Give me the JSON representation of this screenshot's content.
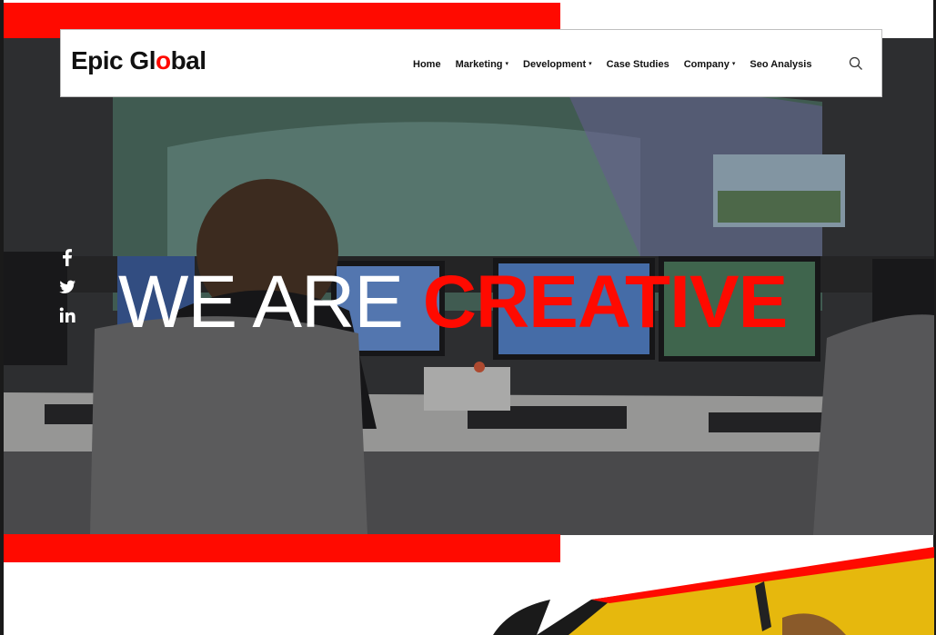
{
  "brand": {
    "name_part1": "Epic Gl",
    "name_accent": "o",
    "name_part2": "bal",
    "accent_color": "#ff0a00"
  },
  "nav": {
    "items": [
      {
        "label": "Home",
        "has_dropdown": false
      },
      {
        "label": "Marketing",
        "has_dropdown": true
      },
      {
        "label": "Development",
        "has_dropdown": true
      },
      {
        "label": "Case Studies",
        "has_dropdown": false
      },
      {
        "label": "Company",
        "has_dropdown": true
      },
      {
        "label": "Seo Analysis",
        "has_dropdown": false
      }
    ],
    "caret": "▾",
    "search_icon": "search-icon"
  },
  "hero": {
    "headline_white": "WE ARE",
    "headline_red": "CREATIVE",
    "image": "control-room-operator-photo"
  },
  "social": [
    {
      "name": "facebook-icon"
    },
    {
      "name": "twitter-icon"
    },
    {
      "name": "linkedin-icon"
    }
  ],
  "colors": {
    "brand_red": "#ff0a00",
    "text_dark": "#111111",
    "headline_white": "#ffffff"
  }
}
